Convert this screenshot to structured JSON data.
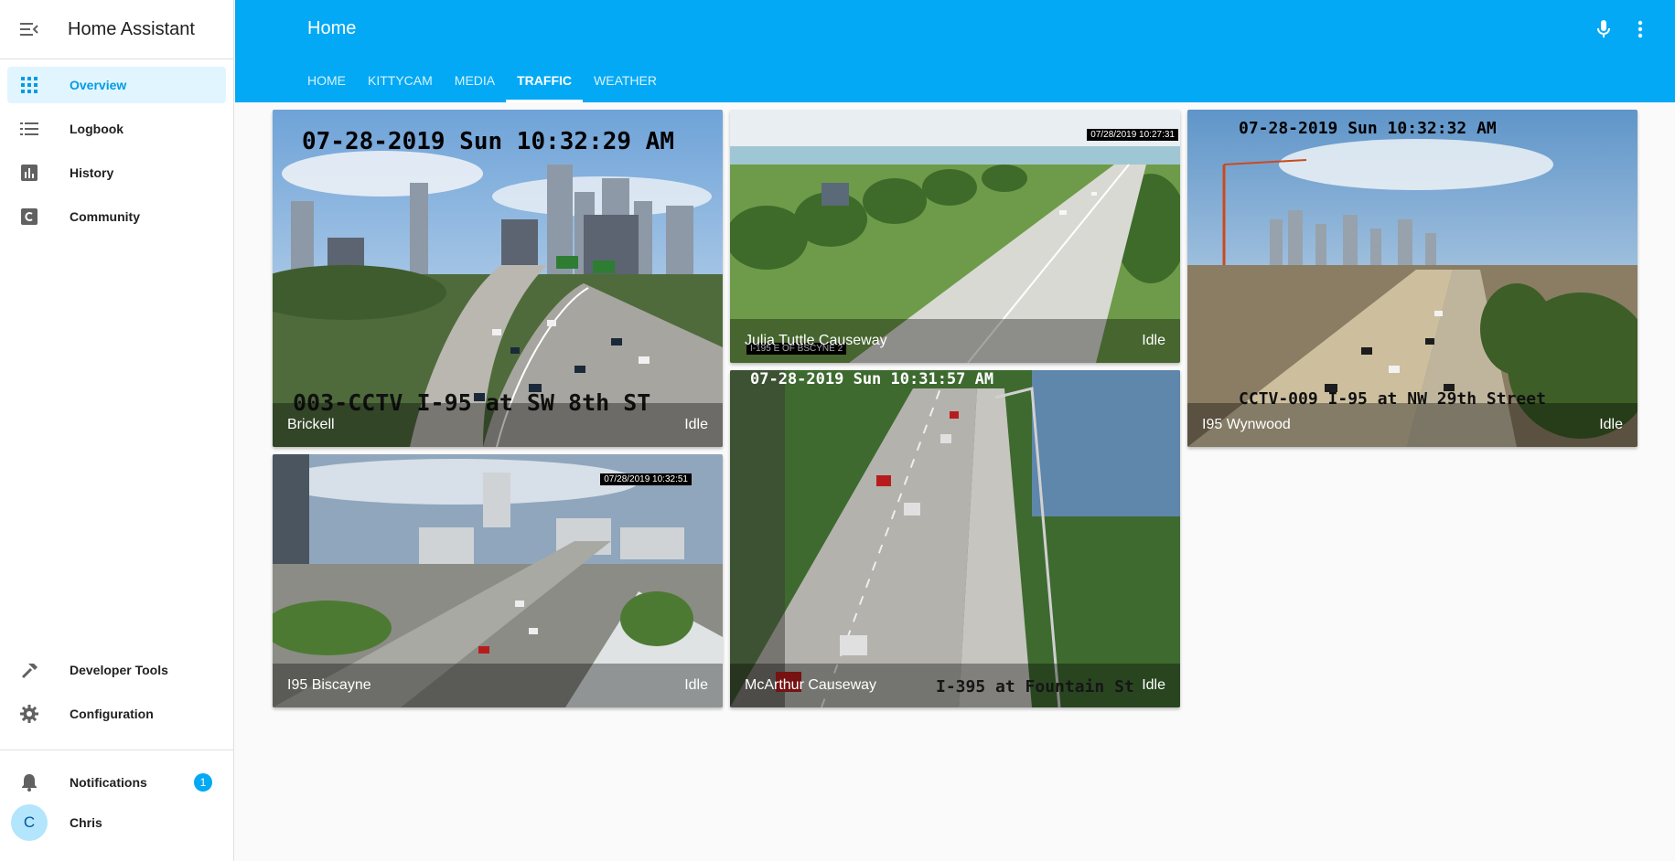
{
  "app": {
    "title": "Home Assistant"
  },
  "sidebar": {
    "items": [
      {
        "label": "Overview",
        "icon": "grid-icon",
        "active": true
      },
      {
        "label": "Logbook",
        "icon": "list-icon"
      },
      {
        "label": "History",
        "icon": "chart-icon"
      },
      {
        "label": "Community",
        "icon": "community-icon"
      }
    ],
    "tools": [
      {
        "label": "Developer Tools",
        "icon": "hammer-icon"
      },
      {
        "label": "Configuration",
        "icon": "gear-icon"
      }
    ],
    "notifications": {
      "label": "Notifications",
      "count": "1",
      "icon": "bell-icon"
    },
    "user": {
      "initial": "C",
      "name": "Chris"
    }
  },
  "header": {
    "title": "Home",
    "tabs": [
      "HOME",
      "KITTYCAM",
      "MEDIA",
      "TRAFFIC",
      "WEATHER"
    ],
    "active_tab": "TRAFFIC"
  },
  "cameras": [
    {
      "name": "Brickell",
      "state": "Idle",
      "timestamp": "07-28-2019 Sun 10:32:29 AM",
      "caption": "003-CCTV I-95 at SW 8th ST"
    },
    {
      "name": "Julia Tuttle Causeway",
      "state": "Idle",
      "timestamp": "07/28/2019  10:27:31",
      "caption": "I-195 E OF BSCYNE 2"
    },
    {
      "name": "I95 Wynwood",
      "state": "Idle",
      "timestamp": "07-28-2019 Sun 10:32:32 AM",
      "caption": "CCTV-009 I-95 at NW 29th Street"
    },
    {
      "name": "I95 Biscayne",
      "state": "Idle",
      "timestamp": "07/28/2019  10:32:51"
    },
    {
      "name": "McArthur Causeway",
      "state": "Idle",
      "timestamp": "07-28-2019 Sun 10:31:57 AM",
      "caption": "I-395 at Fountain St"
    }
  ],
  "colors": {
    "accent": "#03a9f4",
    "active_bg": "#e1f5fe",
    "active_text": "#039be5"
  }
}
